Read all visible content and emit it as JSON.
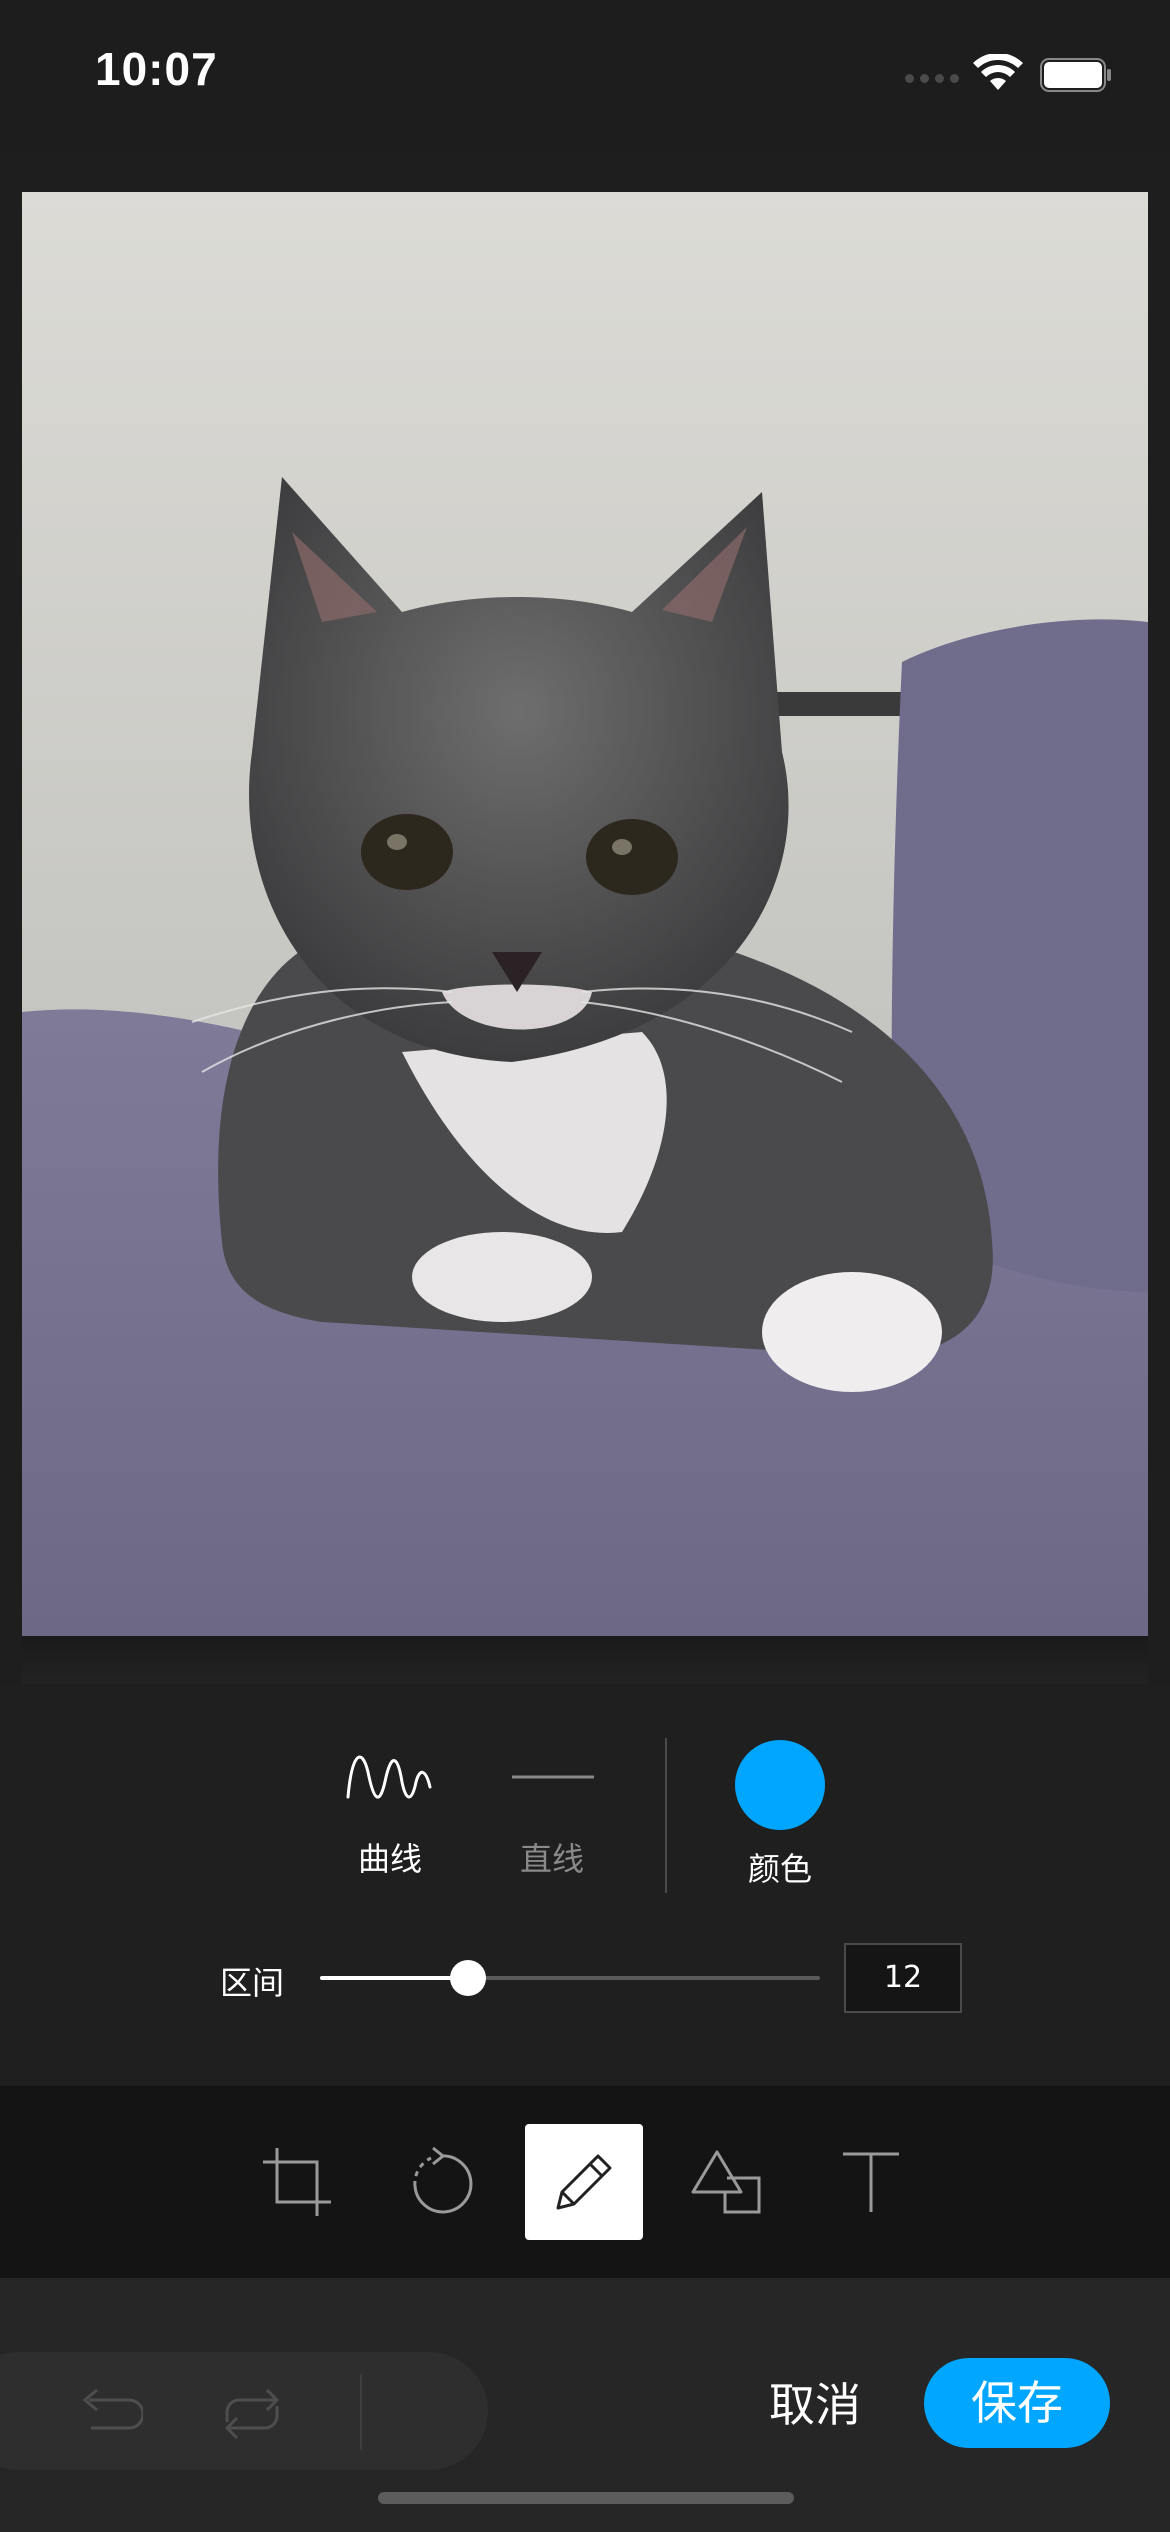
{
  "status_bar": {
    "time": "10:07"
  },
  "photo": {
    "subject": "cat-photo"
  },
  "draw_options": {
    "curve_label": "曲线",
    "line_label": "直线",
    "color_label": "颜色",
    "selected_color": "#00a6ff"
  },
  "range": {
    "label": "区间",
    "value": "12",
    "fraction": 0.295
  },
  "toolbar": {
    "tools": [
      {
        "icon": "crop-icon"
      },
      {
        "icon": "rotate-icon"
      },
      {
        "icon": "pencil-icon",
        "active": true
      },
      {
        "icon": "shapes-icon"
      },
      {
        "icon": "text-icon"
      }
    ]
  },
  "bottom_bar": {
    "cancel_label": "取消",
    "save_label": "保存",
    "accent": "#00a6ff"
  }
}
